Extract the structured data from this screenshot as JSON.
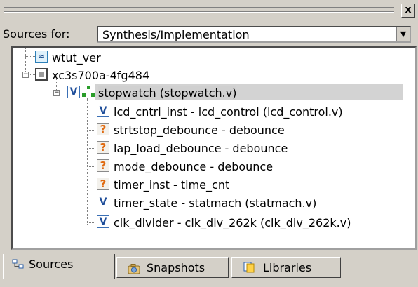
{
  "window": {
    "close_glyph": "x"
  },
  "sources": {
    "label": "Sources for:",
    "selected": "Synthesis/Implementation",
    "dropdown_arrow": "▼"
  },
  "tree": {
    "nodes": [
      {
        "label": "wtut_ver",
        "icon": "waveform-icon"
      },
      {
        "label": "xc3s700a-4fg484",
        "icon": "chip-icon",
        "expander": "−"
      },
      {
        "label": "stopwatch (stopwatch.v)",
        "icon": "verilog-module-icon",
        "expander": "−",
        "selected": true
      },
      {
        "label": "lcd_cntrl_inst - lcd_control (lcd_control.v)",
        "icon": "verilog-module-icon"
      },
      {
        "label": "strtstop_debounce - debounce",
        "icon": "missing-source-icon"
      },
      {
        "label": "lap_load_debounce - debounce",
        "icon": "missing-source-icon"
      },
      {
        "label": "mode_debounce - debounce",
        "icon": "missing-source-icon"
      },
      {
        "label": "timer_inst - time_cnt",
        "icon": "missing-source-icon"
      },
      {
        "label": "timer_state - statmach (statmach.v)",
        "icon": "verilog-module-icon"
      },
      {
        "label": "clk_divider - clk_div_262k (clk_div_262k.v)",
        "icon": "verilog-module-icon"
      }
    ],
    "icon_glyphs": {
      "verilog": "V",
      "missing": "?",
      "wave": "≈"
    }
  },
  "tabs": [
    {
      "label": "Sources",
      "icon": "sources-tab-icon",
      "active": true
    },
    {
      "label": "Snapshots",
      "icon": "snapshots-tab-icon",
      "active": false
    },
    {
      "label": "Libraries",
      "icon": "libraries-tab-icon",
      "active": false
    }
  ],
  "colors": {
    "panel": "#d4d0c8",
    "selection": "#d3d3d3",
    "missing_icon": "#e06a10",
    "verilog_icon": "#1f4e9a"
  }
}
